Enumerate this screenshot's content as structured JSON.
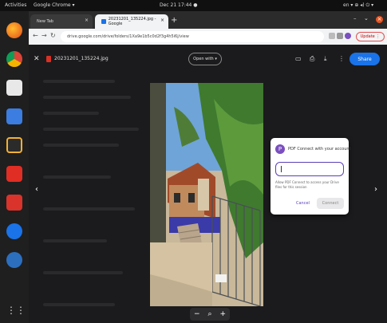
{
  "system": {
    "activities": "Activities",
    "app_name": "Google Chrome ▾",
    "clock": "Dec 21  17:44  ●",
    "tray": "en ▾  ⊕ ◂) ⏻ ▾"
  },
  "tabs": [
    {
      "label": "New Tab",
      "close": "×"
    },
    {
      "label": "20231201_135224.jpg - Google",
      "close": "×"
    }
  ],
  "new_tab": "+",
  "window_controls": [
    "–",
    "⌄",
    "×"
  ],
  "address": {
    "url": "drive.google.com/drive/folders/1Xa9e1b5c0d2f3g4h5i6j/view",
    "update_label": "Update ⋮"
  },
  "viewer": {
    "file_name": "20231201_135224.jpg",
    "open_with": "Open with ▾",
    "share": "Share",
    "icons": [
      "comment-icon",
      "print-icon",
      "download-icon",
      "more-icon"
    ],
    "prev": "‹",
    "next": "›",
    "zoom": {
      "minus": "−",
      "glass": "⌕",
      "plus": "+"
    }
  },
  "dialog": {
    "logo": "P",
    "title": "PDF Connect with your account",
    "input_value": "",
    "hint": "Allow PDF Connect to access your Drive files for this session",
    "cancel": "Cancel",
    "connect": "Connect"
  },
  "colors": {
    "share_blue": "#1a73e8",
    "accent_purple": "#5b3fb8"
  }
}
